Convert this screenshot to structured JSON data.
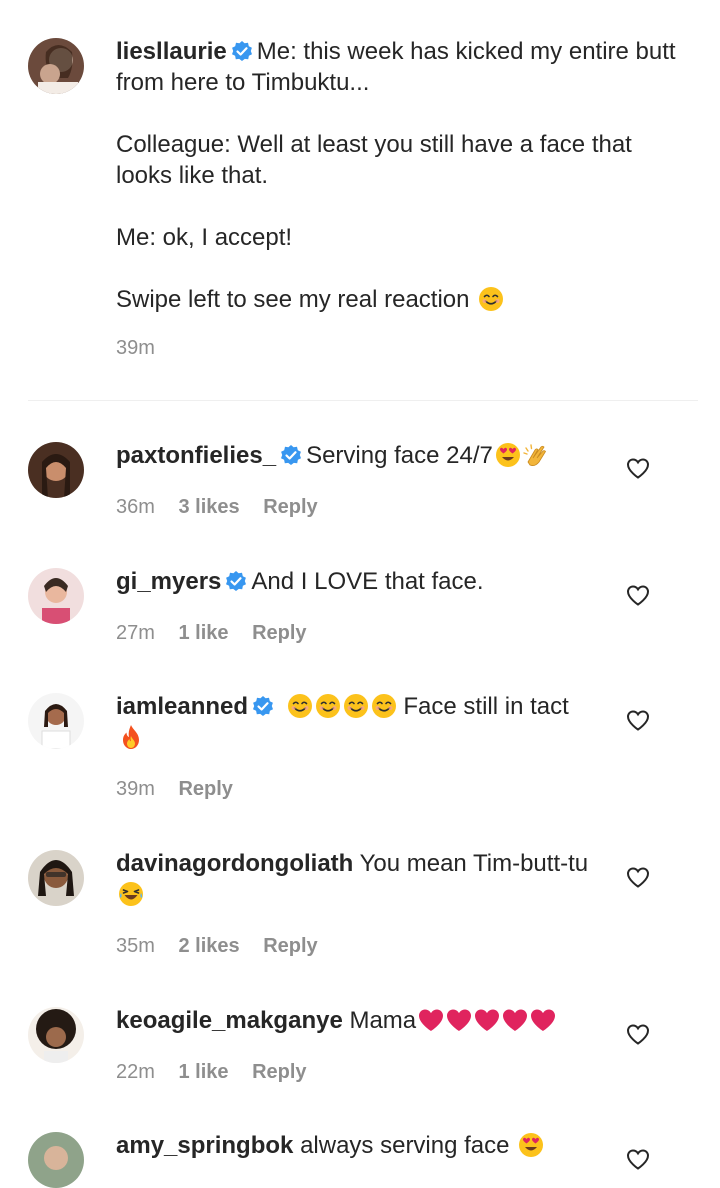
{
  "post": {
    "username": "liesllaurie",
    "lines": [
      "Me: this week has kicked my entire butt from here to Timbuktu...",
      "Colleague: Well at least you still have a face that looks like that.",
      "Me: ok, I accept!",
      "Swipe left to see my real reaction"
    ],
    "time": "39m"
  },
  "comments": [
    {
      "username": "paxtonfielies_",
      "text": "Serving face 24/7",
      "time": "36m",
      "likes": "3 likes",
      "reply": "Reply"
    },
    {
      "username": "gi_myers",
      "text": "And I LOVE that face.",
      "time": "27m",
      "likes": "1 like",
      "reply": "Reply"
    },
    {
      "username": "iamleanned",
      "text": "Face still in tact",
      "time": "39m",
      "reply": "Reply"
    },
    {
      "username": "davinagordongoliath",
      "text": "You mean Tim-butt-tu",
      "time": "35m",
      "likes": "2 likes",
      "reply": "Reply"
    },
    {
      "username": "keoagile_makganye",
      "text": "Mama",
      "time": "22m",
      "likes": "1 like",
      "reply": "Reply"
    },
    {
      "username": "amy_springbok",
      "text": "always serving face"
    }
  ],
  "colors": {
    "verified": "#3897f0",
    "meta": "#8e8e8e",
    "heart_red": "#e0245e"
  }
}
